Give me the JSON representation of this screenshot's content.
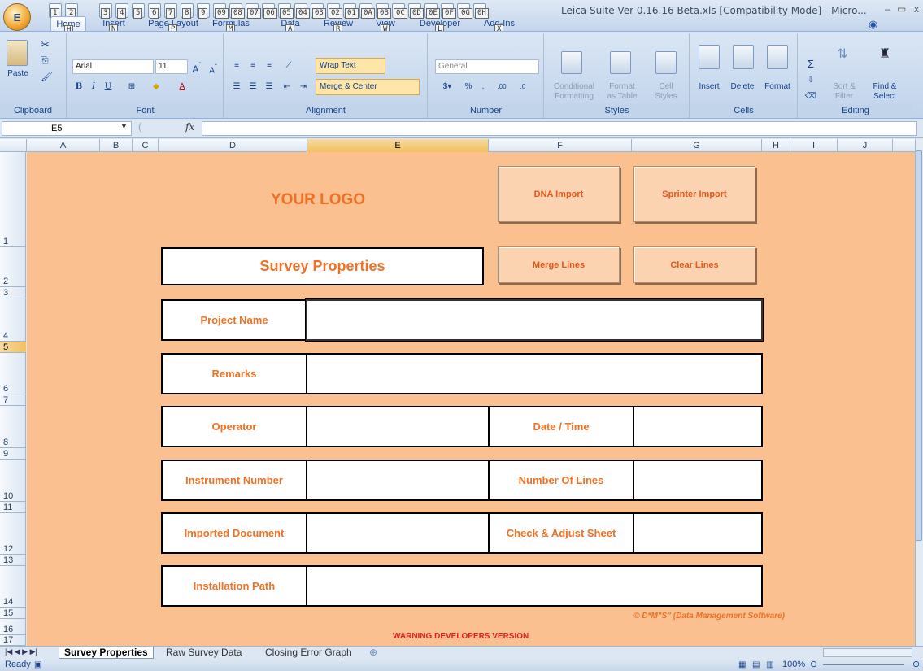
{
  "window": {
    "title": "Leica Suite  Ver 0.16.16 Beta.xls  [Compatibility Mode] - Micro...",
    "controls": [
      "–",
      "▭",
      "x"
    ]
  },
  "office_button": "E",
  "qat_keytips": [
    "1",
    "2",
    "3",
    "4",
    "5",
    "6",
    "7",
    "8",
    "9",
    "09",
    "08",
    "07",
    "06",
    "05",
    "04",
    "03",
    "02",
    "01",
    "0A",
    "0B",
    "0C",
    "0D",
    "0E",
    "0F",
    "0G",
    "0H"
  ],
  "tabs": [
    {
      "label": "Home",
      "key": "H"
    },
    {
      "label": "Insert",
      "key": "N"
    },
    {
      "label": "Page Layout",
      "key": "P"
    },
    {
      "label": "Formulas",
      "key": "M"
    },
    {
      "label": "Data",
      "key": "A"
    },
    {
      "label": "Review",
      "key": "R"
    },
    {
      "label": "View",
      "key": "W"
    },
    {
      "label": "Developer",
      "key": "L"
    },
    {
      "label": "Add-Ins",
      "key": "X"
    }
  ],
  "ribbon": {
    "clipboard": {
      "label": "Clipboard",
      "paste": "Paste"
    },
    "font": {
      "label": "Font",
      "family": "Arial",
      "size": "11"
    },
    "alignment": {
      "label": "Alignment",
      "wrap": "Wrap Text",
      "merge": "Merge & Center"
    },
    "number": {
      "label": "Number",
      "format": "General"
    },
    "styles": {
      "label": "Styles",
      "conditional": "Conditional",
      "conditional2": "Formatting",
      "format_table": "Format",
      "format_table2": "as Table",
      "cell_styles": "Cell",
      "cell_styles2": "Styles"
    },
    "cells": {
      "label": "Cells",
      "insert": "Insert",
      "delete": "Delete",
      "format": "Format"
    },
    "editing": {
      "label": "Editing",
      "sort": "Sort &",
      "sort2": "Filter",
      "find": "Find &",
      "find2": "Select"
    }
  },
  "formula_bar": {
    "name_box": "E5",
    "fx": "fx",
    "value": ""
  },
  "columns": [
    {
      "label": "A"
    },
    {
      "label": "B"
    },
    {
      "label": "C"
    },
    {
      "label": "D"
    },
    {
      "label": "E",
      "selected": true
    },
    {
      "label": "F"
    },
    {
      "label": "G"
    },
    {
      "label": "H"
    },
    {
      "label": "I"
    },
    {
      "label": "J"
    }
  ],
  "rows": [
    "1",
    "2",
    "3",
    "4",
    "5",
    "6",
    "7",
    "8",
    "9",
    "10",
    "11",
    "12",
    "13",
    "14",
    "15",
    "16",
    "17"
  ],
  "sheet": {
    "logo": "YOUR LOGO",
    "buttons": {
      "dna": "DNA Import",
      "sprinter": "Sprinter Import",
      "merge": "Merge Lines",
      "clear": "Clear Lines"
    },
    "title": "Survey Properties",
    "fields": {
      "project_name": "Project Name",
      "remarks": "Remarks",
      "operator": "Operator",
      "date_time": "Date / Time",
      "instrument": "Instrument Number",
      "num_lines": "Number Of Lines",
      "imported_doc": "Imported Document",
      "check_adjust": "Check & Adjust Sheet",
      "install_path": "Installation Path"
    },
    "copyright": "© D*M\"S\"  (Data Management Software)",
    "warning": "WARNING DEVELOPERS VERSION"
  },
  "sheet_tabs": [
    "Survey Properties",
    "Raw Survey Data",
    "Closing Error Graph"
  ],
  "status": {
    "ready": "Ready",
    "zoom": "100%"
  }
}
